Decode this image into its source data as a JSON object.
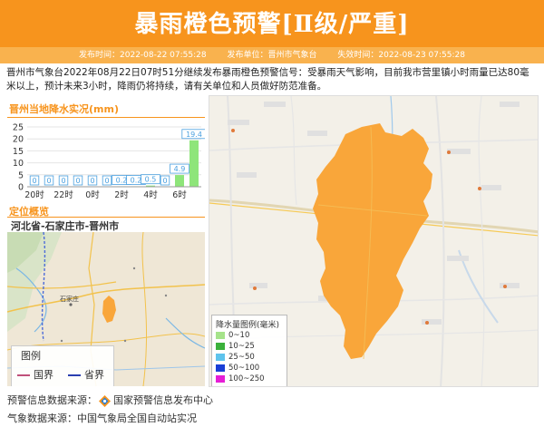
{
  "header": {
    "title": "暴雨橙色预警[Ⅱ级/严重]",
    "color": "#f7941d"
  },
  "meta": {
    "issue_time": "发布时间：2022-08-22 07:55:28",
    "issuer": "发布单位：晋州市气象台",
    "expire_time": "失效时间：2022-08-23 07:55:28"
  },
  "description": "晋州市气象台2022年08月22日07时51分继续发布暴雨橙色预警信号：受暴雨天气影响，目前我市营里镇小时雨量已达80毫米以上，预计未来3小时，降雨仍将持续，请有关单位和人员做好防范准备。",
  "rain_panel": {
    "title": "晋州当地降水实况(mm)"
  },
  "chart_data": {
    "type": "bar",
    "title": "晋州当地降水实况(mm)",
    "ylim": [
      0,
      25
    ],
    "y_ticks": [
      "0",
      "5",
      "10",
      "15",
      "20",
      "25"
    ],
    "x_tick_labels": [
      "20时",
      "22时",
      "0时",
      "2时",
      "4时",
      "6时"
    ],
    "values": [
      0,
      0,
      0,
      0,
      0,
      0,
      0.2,
      0.2,
      0.5,
      0,
      4.9,
      19.4
    ],
    "data_labels": [
      "0",
      "0",
      "0",
      "0",
      "0",
      "0",
      "0.2",
      "0.2",
      "0.5",
      "0",
      "4.9",
      "19.4"
    ],
    "bar_color": "#8ee57a",
    "label_color": "#4aa0e0"
  },
  "location_panel": {
    "title": "定位概览",
    "region": "河北省-石家庄市-晋州市"
  },
  "minimap": {
    "city_label": "石家庄",
    "legend_title": "图例",
    "legend_items": [
      {
        "label": "国界",
        "color": "#c0507a"
      },
      {
        "label": "省界",
        "color": "#2a3fb0"
      }
    ]
  },
  "rain_legend": {
    "title": "降水量图例(毫米)",
    "items": [
      {
        "label": "0~10",
        "color": "#a6e38a"
      },
      {
        "label": "10~25",
        "color": "#3bb13b"
      },
      {
        "label": "25~50",
        "color": "#5ec3ec"
      },
      {
        "label": "50~100",
        "color": "#1a3fd6"
      },
      {
        "label": "100~250",
        "color": "#e61ed6"
      }
    ]
  },
  "region_fill_color": "#f9a63a",
  "footer": {
    "warning_source": "预警信息数据来源：",
    "warning_center": "国家预警信息发布中心",
    "weather_source": "气象数据来源：中国气象局全国自动站实况"
  }
}
